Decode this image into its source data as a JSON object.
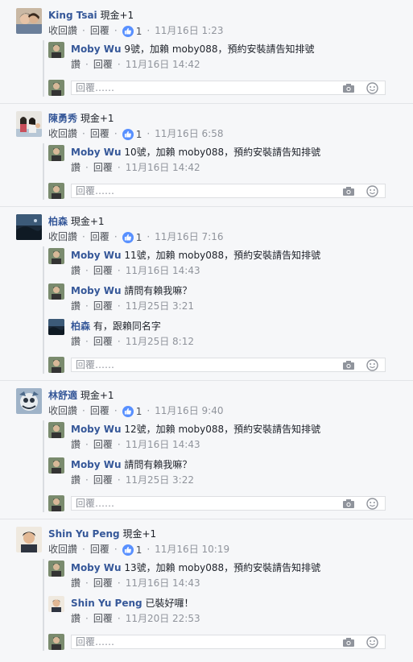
{
  "actions": {
    "like": "讚",
    "unlike": "收回讚",
    "reply": "回覆",
    "separator": "·"
  },
  "reply_placeholder": "回覆……",
  "colors": {
    "name": "#365899",
    "meta": "#90949c",
    "like_blue": "#5890ff",
    "background": "#f6f7f9"
  },
  "threads": [
    {
      "author": "King Tsai",
      "text": "現金+1",
      "like_count": "1",
      "time": "11月16日 1:23",
      "replies": [
        {
          "author": "Moby Wu",
          "text": "9號，加賴 moby088，預約安裝請告知排號",
          "time": "11月16日 14:42"
        }
      ]
    },
    {
      "author": "陳勇秀",
      "text": "現金+1",
      "like_count": "1",
      "time": "11月16日 6:58",
      "replies": [
        {
          "author": "Moby Wu",
          "text": "10號，加賴 moby088，預約安裝請告知排號",
          "time": "11月16日 14:42"
        }
      ]
    },
    {
      "author": "柏森",
      "text": "現金+1",
      "like_count": "1",
      "time": "11月16日 7:16",
      "replies": [
        {
          "author": "Moby Wu",
          "text": "11號，加賴 moby088，預約安裝請告知排號",
          "time": "11月16日 14:43"
        },
        {
          "author": "Moby Wu",
          "text": "請問有賴我嘛？",
          "time": "11月25日 3:21"
        },
        {
          "author": "柏森",
          "text": "有，跟賴同名字",
          "time": "11月25日 8:12"
        }
      ]
    },
    {
      "author": "林舒適",
      "text": "現金+1",
      "like_count": "1",
      "time": "11月16日 9:40",
      "replies": [
        {
          "author": "Moby Wu",
          "text": "12號，加賴 moby088，預約安裝請告知排號",
          "time": "11月16日 14:43"
        },
        {
          "author": "Moby Wu",
          "text": "請問有賴我嘛？",
          "time": "11月25日 3:22"
        }
      ]
    },
    {
      "author": "Shin Yu Peng",
      "text": "現金+1",
      "like_count": "1",
      "time": "11月16日 10:19",
      "replies": [
        {
          "author": "Moby Wu",
          "text": "13號，加賴 moby088，預約安裝請告知排號",
          "time": "11月16日 14:43"
        },
        {
          "author": "Shin Yu Peng",
          "text": "已裝好囉！",
          "time": "11月20日 22:53"
        }
      ]
    }
  ]
}
